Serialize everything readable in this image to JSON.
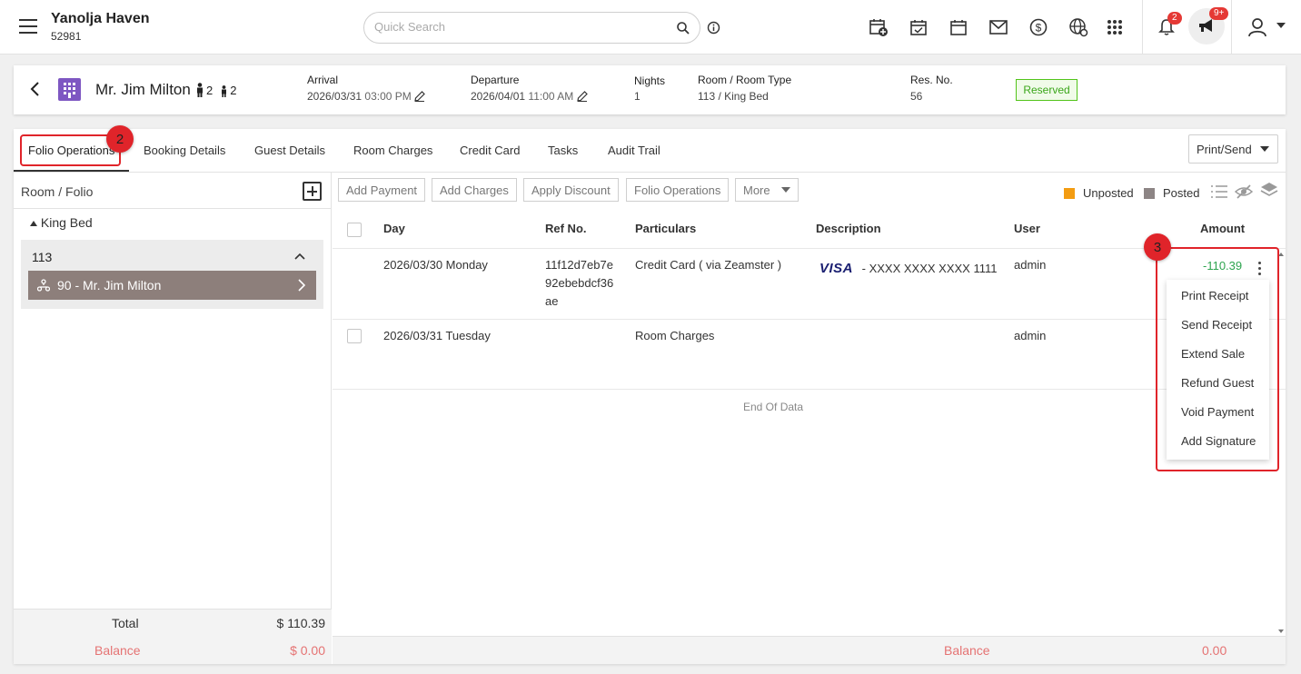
{
  "topbar": {
    "hotel_name": "Yanolja Haven",
    "hotel_id": "52981",
    "search_placeholder": "Quick Search",
    "notification_count": "2",
    "announcement_count": "9+"
  },
  "reservation": {
    "guest_name": "Mr. Jim Milton",
    "adults": "2",
    "children": "2",
    "arrival_label": "Arrival",
    "arrival_date": "2026/03/31",
    "arrival_time": "03:00 PM",
    "departure_label": "Departure",
    "departure_date": "2026/04/01",
    "departure_time": "11:00 AM",
    "nights_label": "Nights",
    "nights": "1",
    "room_label": "Room / Room Type",
    "room_value": "113 / King Bed",
    "resno_label": "Res. No.",
    "resno": "56",
    "status": "Reserved",
    "status_color": "#52c41a"
  },
  "tabs": [
    {
      "label": "Folio Operations",
      "active": true
    },
    {
      "label": "Booking Details"
    },
    {
      "label": "Guest Details"
    },
    {
      "label": "Room Charges"
    },
    {
      "label": "Credit Card"
    },
    {
      "label": "Tasks"
    },
    {
      "label": "Audit Trail"
    }
  ],
  "print_send": "Print/Send",
  "left_panel": {
    "header": "Room / Folio",
    "room_type": "King Bed",
    "room_number": "113",
    "folio_label": "90 - Mr. Jim Milton",
    "total_label": "Total",
    "total_value": "$ 110.39",
    "balance_label": "Balance",
    "balance_value": "$ 0.00"
  },
  "toolbar": {
    "add_payment": "Add Payment",
    "add_charges": "Add Charges",
    "apply_discount": "Apply Discount",
    "folio_operations": "Folio Operations",
    "more": "More",
    "legend_unposted": "Unposted",
    "legend_posted": "Posted",
    "unposted_color": "#f39c12",
    "posted_color": "#8d8585"
  },
  "table": {
    "headers": {
      "day": "Day",
      "ref": "Ref No.",
      "particulars": "Particulars",
      "description": "Description",
      "user": "User",
      "amount": "Amount"
    },
    "rows": [
      {
        "day": "2026/03/30 Monday",
        "ref_line1": "11f12d7eb7e",
        "ref_line2": "92ebebdcf36",
        "ref_line3": "ae",
        "particulars": "Credit Card ( via Zeamster )",
        "card_brand": "VISA",
        "description": "- XXXX XXXX XXXX 1111",
        "user": "admin",
        "amount": "-110.39"
      },
      {
        "day": "2026/03/31 Tuesday",
        "particulars": "Room Charges",
        "user": "admin"
      }
    ],
    "end_of_data": "End Of Data",
    "balance_label": "Balance",
    "balance_value": "0.00"
  },
  "context_menu": {
    "items": [
      "Print Receipt",
      "Send Receipt",
      "Extend Sale",
      "Refund Guest",
      "Void Payment",
      "Add Signature"
    ]
  },
  "annotations": {
    "step2": "2",
    "step3": "3"
  }
}
